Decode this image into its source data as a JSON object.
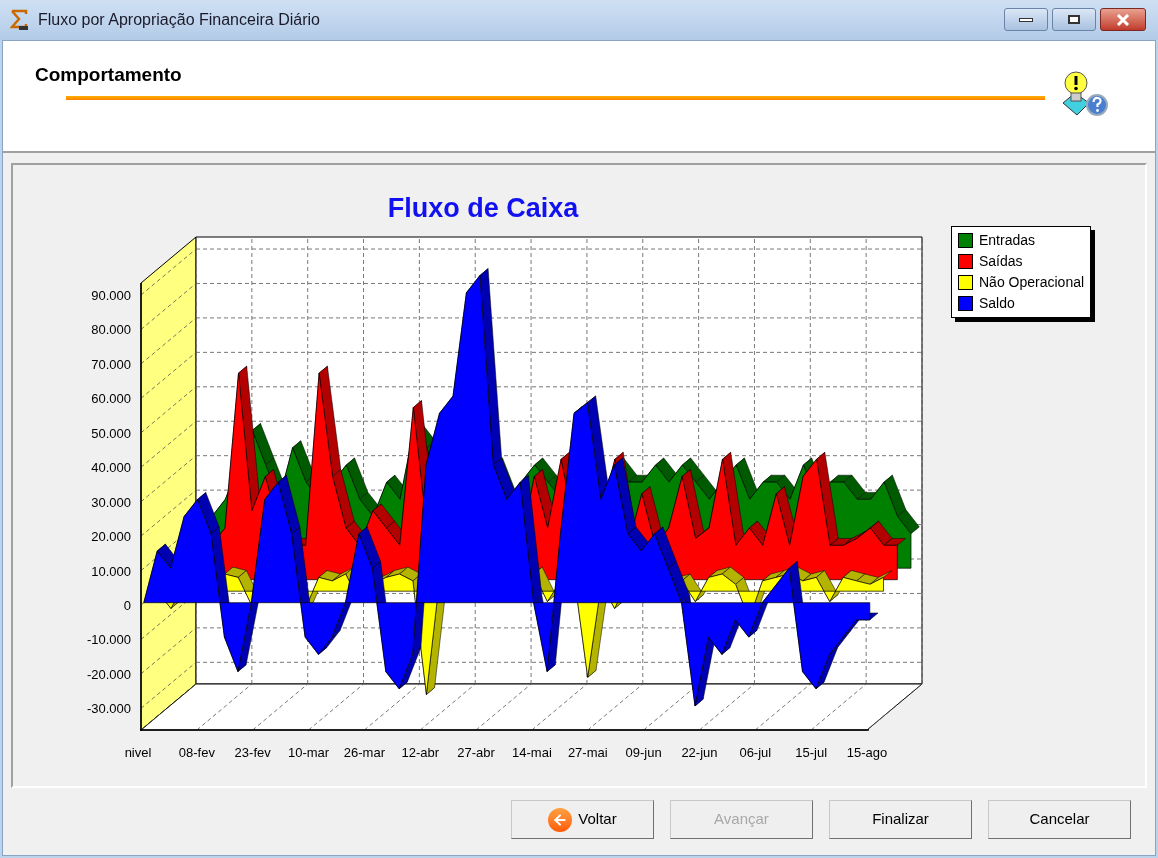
{
  "window": {
    "title": "Fluxo por Apropriação Financeira Diário"
  },
  "header": {
    "title": "Comportamento"
  },
  "chart": {
    "title": "Fluxo de Caixa",
    "y_labels": [
      "90.000",
      "80.000",
      "70.000",
      "60.000",
      "50.000",
      "40.000",
      "30.000",
      "20.000",
      "10.000",
      "0",
      "-10.000",
      "-20.000",
      "-30.000"
    ],
    "x_labels": [
      "nivel",
      "08-fev",
      "23-fev",
      "10-mar",
      "26-mar",
      "12-abr",
      "27-abr",
      "14-mai",
      "27-mai",
      "09-jun",
      "22-jun",
      "06-jul",
      "15-jul",
      "15-ago"
    ],
    "legend": [
      {
        "name": "Entradas",
        "color": "#008000"
      },
      {
        "name": "Saídas",
        "color": "#ff0000"
      },
      {
        "name": "Não Operacional",
        "color": "#ffff00"
      },
      {
        "name": "Saldo",
        "color": "#0000ff"
      }
    ]
  },
  "buttons": [
    {
      "label": "Voltar",
      "disabled": false,
      "kind": "back"
    },
    {
      "label": "Avançar",
      "disabled": true,
      "kind": "plain"
    },
    {
      "label": "Finalizar",
      "disabled": false,
      "kind": "plain"
    },
    {
      "label": "Cancelar",
      "disabled": false,
      "kind": "plain"
    }
  ]
}
